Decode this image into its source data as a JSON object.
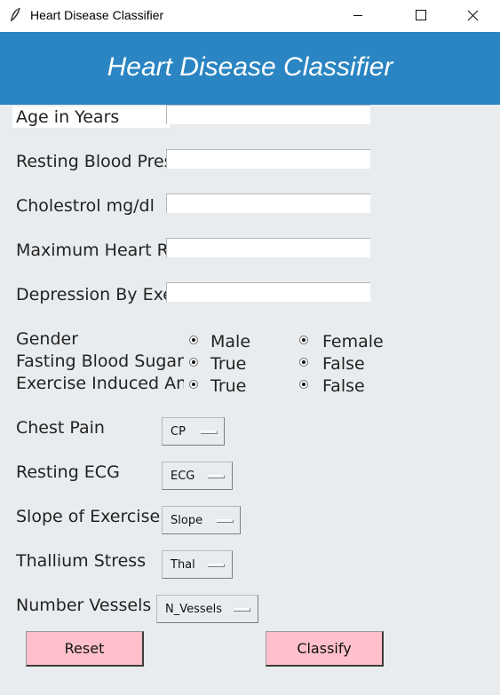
{
  "window": {
    "title": "Heart Disease Classifier",
    "icon": "feather-icon",
    "controls": [
      "minimize-icon",
      "maximize-icon",
      "close-icon"
    ]
  },
  "header": {
    "title": "Heart Disease Classifier",
    "background": "#2a85c2"
  },
  "fields": [
    {
      "label": "Age in Years",
      "value": ""
    },
    {
      "label": "Resting Blood Pressure",
      "value": ""
    },
    {
      "label": "Cholestrol mg/dl",
      "value": ""
    },
    {
      "label": "Maximum Heart Rate",
      "value": ""
    },
    {
      "label": "Depression By Exercise",
      "value": ""
    }
  ],
  "radios": [
    {
      "label": "Gender",
      "option1": "Male",
      "option2": "Female"
    },
    {
      "label": "Fasting Blood Sugar",
      "option1": "True",
      "option2": "False"
    },
    {
      "label": "Exercise Induced Angina",
      "option1": "True",
      "option2": "False"
    }
  ],
  "selects": [
    {
      "label": "Chest Pain",
      "value": "CP"
    },
    {
      "label": "Resting ECG",
      "value": "ECG"
    },
    {
      "label": "Slope of Exercise",
      "value": "Slope"
    },
    {
      "label": "Thallium Stress",
      "value": "Thal"
    },
    {
      "label": "Number Vessels",
      "value": "N_Vessels"
    }
  ],
  "buttons": {
    "reset": "Reset",
    "classify": "Classify",
    "color": "#ffc0cb"
  }
}
